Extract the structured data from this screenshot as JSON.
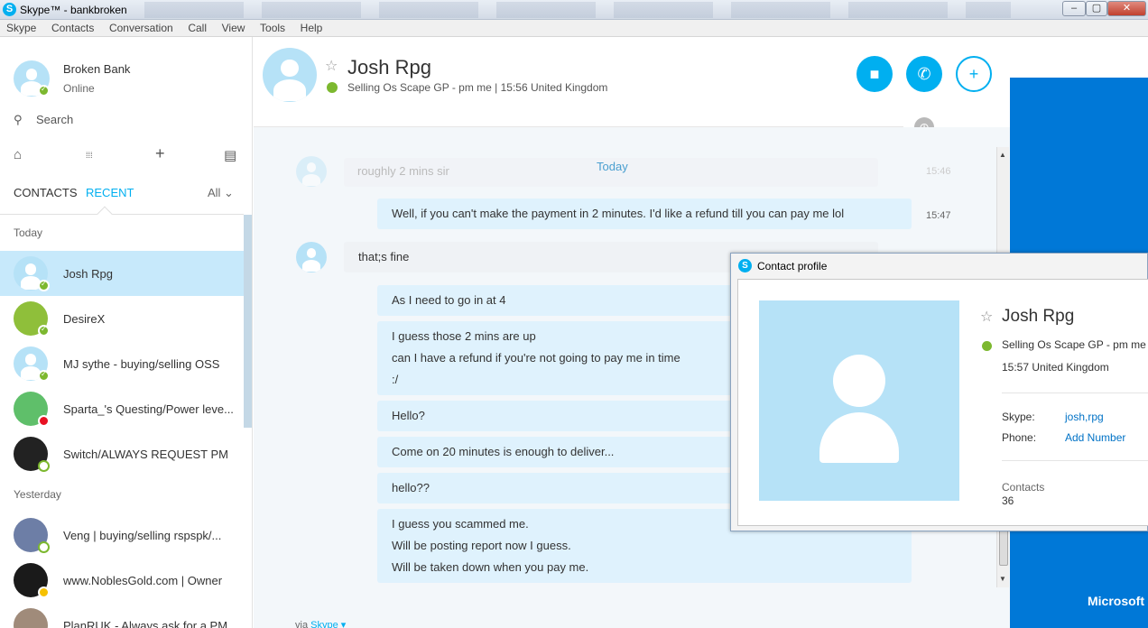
{
  "window": {
    "title": "Skype™ - bankbroken",
    "minimize_glyph": "–",
    "maximize_glyph": "▢",
    "close_glyph": "✕"
  },
  "menu": [
    "Skype",
    "Contacts",
    "Conversation",
    "Call",
    "View",
    "Tools",
    "Help"
  ],
  "me": {
    "name": "Broken Bank",
    "status": "Online"
  },
  "search": {
    "label": "Search",
    "icon": "search-icon"
  },
  "tools": {
    "home_icon": "⌂",
    "dialpad_icon": "⁞⁞⁞",
    "add_icon": "+",
    "bot_icon": "▤"
  },
  "tabs": {
    "contacts": "CONTACTS",
    "recent": "RECENT",
    "all": "All ⌄"
  },
  "sidebar": {
    "sections": [
      "Today",
      "Yesterday"
    ],
    "contacts": [
      {
        "name": "Josh Rpg",
        "status": "online",
        "selected": true
      },
      {
        "name": "DesireX",
        "status": "online"
      },
      {
        "name": "MJ sythe - buying/selling OSS",
        "status": "online"
      },
      {
        "name": "Sparta_'s Questing/Power leve...",
        "status": "busy"
      },
      {
        "name": "Switch/ALWAYS REQUEST PM",
        "status": "away"
      },
      {
        "name": "Veng | buying/selling rspspk/...",
        "status": "away"
      },
      {
        "name": "www.NoblesGold.com | Owner",
        "status": "idle"
      },
      {
        "name": "PlanRUK - Always ask for a PM",
        "status": "online"
      }
    ]
  },
  "header": {
    "name": "Josh Rpg",
    "mood": "Selling Os Scape GP - pm me  |  15:56 United Kingdom",
    "star": "☆",
    "video_icon": "■",
    "call_icon": "✆",
    "add_icon": "+"
  },
  "chat": {
    "faded_text": "roughly 2 mins sir",
    "faded_time": "15:46",
    "today": "Today",
    "messages": [
      {
        "text": "Well, if you can't make the payment in 2 minutes. I'd like a refund till you can pay me lol",
        "time": "15:47"
      },
      {
        "text": "that;s fine"
      },
      {
        "text": "As I need to go in at 4"
      },
      {
        "line1": "I guess those 2 mins are up",
        "line2": "can I have a refund if you're not going to pay me in time",
        "line3": ":/"
      },
      {
        "text": "Hello?"
      },
      {
        "text": "Come on 20 minutes is enough to deliver..."
      },
      {
        "text": "hello??"
      },
      {
        "line1": "I guess you scammed me.",
        "line2": "Will be posting report now I guess.",
        "line3": "Will be taken down when you pay me."
      }
    ],
    "via_prefix": "via ",
    "via_link": "Skype ▾"
  },
  "ad": {
    "brand": "Microsoft"
  },
  "profile": {
    "title": "Contact profile",
    "name": "Josh Rpg",
    "mood": "Selling Os Scape GP - pm me",
    "time": "15:57 United Kingdom",
    "skype_label": "Skype:",
    "skype_value": "josh,rpg",
    "phone_label": "Phone:",
    "phone_value": "Add Number",
    "contacts_label": "Contacts",
    "contacts_value": "36"
  },
  "colors": {
    "accent": "#00aff0",
    "online": "#7cb82f",
    "busy": "#e81123",
    "selected_row": "#c7e9fb",
    "ad_blue": "#0078d7"
  }
}
